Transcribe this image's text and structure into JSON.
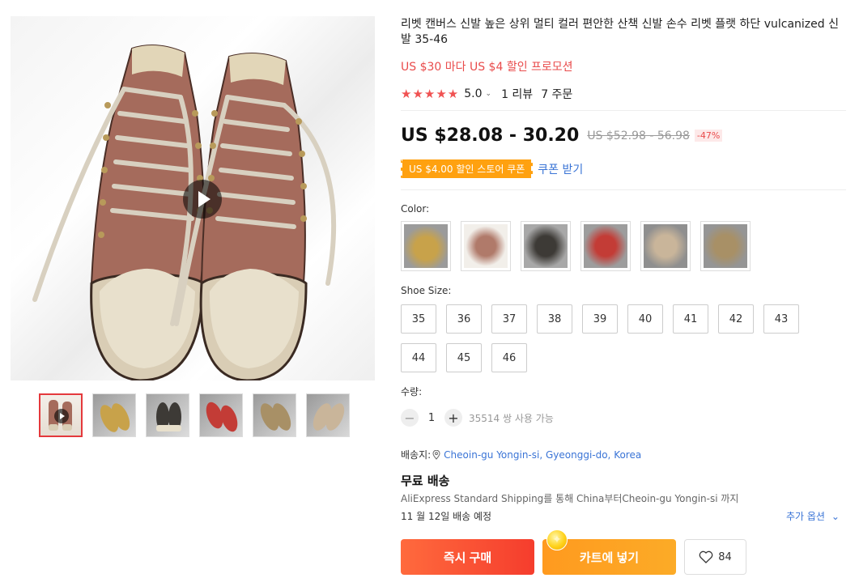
{
  "product": {
    "title": "리벳 캔버스 신발 높은 상위 멀티 컬러 편안한 산책 신발 손수 리벳 플랫 하단 vulcanized 신발 35-46",
    "promo": "US $30 마다 US $4 할인 프로모션",
    "rating": {
      "value": "5.0",
      "stars": "★★★★★",
      "reviews": "1 리뷰",
      "orders": "7 주문"
    },
    "price": {
      "current": "US $28.08 - 30.20",
      "original": "US $52.98 - 56.98",
      "discount": "-47%"
    },
    "coupon": {
      "badge": "US $4.00 할인 스토어 쿠폰",
      "action": "쿠폰 받기"
    }
  },
  "color": {
    "label": "Color:",
    "swatches": [
      {
        "name": "yellow",
        "color": "#c8a24a"
      },
      {
        "name": "pink",
        "color": "#b07a6a"
      },
      {
        "name": "black",
        "color": "#3d3a36"
      },
      {
        "name": "red",
        "color": "#c33c36"
      },
      {
        "name": "beige",
        "color": "#c9b59a"
      },
      {
        "name": "khaki",
        "color": "#a89066"
      }
    ]
  },
  "size": {
    "label": "Shoe Size:",
    "options": [
      "35",
      "36",
      "37",
      "38",
      "39",
      "40",
      "41",
      "42",
      "43",
      "44",
      "45",
      "46"
    ]
  },
  "quantity": {
    "label": "수량:",
    "value": "1",
    "minus": "−",
    "plus": "+",
    "available": "35514 쌍 사용 가능"
  },
  "shipping": {
    "to_label": "배송지:",
    "to_location": "Cheoin-gu Yongin-si, Gyeonggi-do, Korea",
    "free": "무료 배송",
    "method": "AliExpress Standard Shipping를 통해 China부터Cheoin-gu Yongin-si 까지",
    "estimate": "11 월 12일 배송 예정",
    "more": "추가 옵션"
  },
  "actions": {
    "buy_now": "즉시 구매",
    "add_to_cart": "카트에 넣기",
    "wishlist_count": "84"
  },
  "icons": {
    "play": "play-icon",
    "pin": "location-pin-icon",
    "heart": "heart-icon",
    "chevron": "chevron-down-icon"
  }
}
